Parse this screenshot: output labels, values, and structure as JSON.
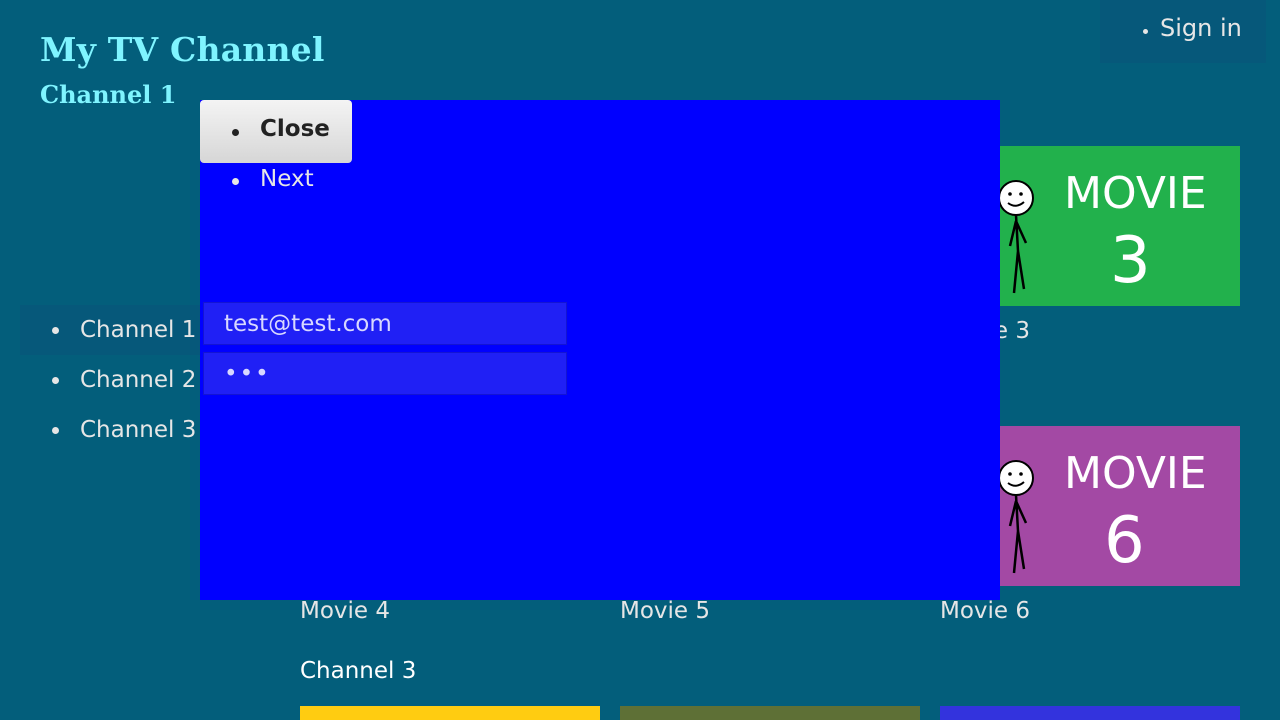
{
  "header": {
    "app_title": "My TV Channel",
    "channel_title": "Channel 1",
    "sign_in": "Sign in"
  },
  "sidebar": {
    "channels": [
      {
        "label": "Channel 1",
        "active": true
      },
      {
        "label": "Channel 2",
        "active": false
      },
      {
        "label": "Channel 3",
        "active": false
      }
    ]
  },
  "main": {
    "movies": [
      {
        "label": "Movie 3",
        "tile_text": "MOVIE",
        "tile_number": "3",
        "color": "#22b14c"
      },
      {
        "label": "Movie 4"
      },
      {
        "label": "Movie 5"
      },
      {
        "label": "Movie 6",
        "tile_text": "MOVIE",
        "tile_number": "6",
        "color": "#a349a4"
      }
    ],
    "section_channel3": "Channel 3",
    "bottom_tile_colors": [
      "#ffcc11",
      "#5e7036",
      "#3333dd"
    ]
  },
  "modal": {
    "close_label": "Close",
    "next_label": "Next",
    "email_value": "test@test.com",
    "password_value": "•••",
    "background": "#0000ff"
  }
}
